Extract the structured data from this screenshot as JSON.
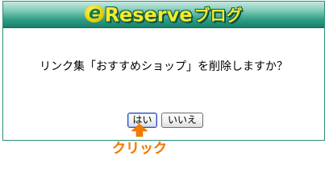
{
  "header": {
    "logo_e": "e",
    "logo_reserve": "Reserve",
    "logo_blog": "ブログ"
  },
  "dialog": {
    "message": "リンク集「おすすめショップ」を削除しますか？",
    "yes_label": "はい",
    "no_label": "いいえ"
  },
  "annotation": {
    "click_label": "クリック",
    "arrow_icon": "arrow-up-icon"
  },
  "colors": {
    "banner": "#2f9d85",
    "logo_text": "#f6ea2b",
    "callout": "#f47a00"
  }
}
